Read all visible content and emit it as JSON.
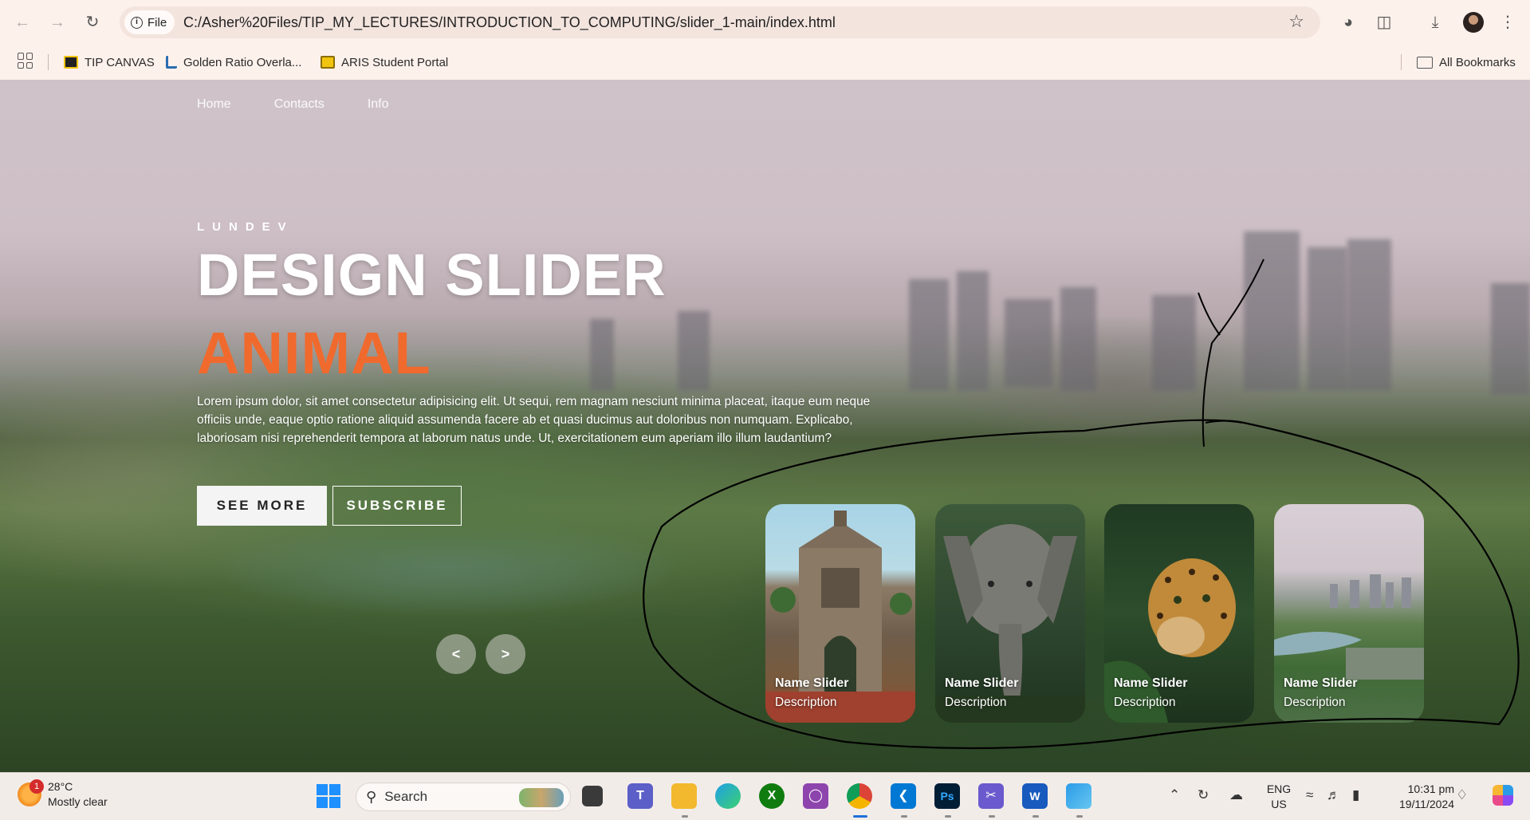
{
  "browser": {
    "back_icon": "back-arrow-icon",
    "forward_icon": "forward-arrow-icon",
    "reload_icon": "reload-icon",
    "site_chip_label": "File",
    "url": "C:/Asher%20Files/TIP_MY_LECTURES/INTRODUCTION_TO_COMPUTING/slider_1-main/index.html",
    "bookmarks": [
      {
        "label": "TIP CANVAS",
        "icon": "tip-canvas-favicon"
      },
      {
        "label": "Golden Ratio Overla...",
        "icon": "golden-ratio-favicon"
      },
      {
        "label": "ARIS Student Portal",
        "icon": "aris-favicon"
      }
    ],
    "all_bookmarks_label": "All Bookmarks"
  },
  "page": {
    "nav": [
      "Home",
      "Contacts",
      "Info"
    ],
    "author": "LUNDEV",
    "title": "DESIGN SLIDER",
    "topic": "ANIMAL",
    "description": "Lorem ipsum dolor, sit amet consectetur adipisicing elit. Ut sequi, rem magnam nesciunt minima placeat, itaque eum neque officiis unde, eaque optio ratione aliquid assumenda facere ab et quasi ducimus aut doloribus non numquam. Explicabo, laboriosam nisi reprehenderit tempora at laborum natus unde. Ut, exercitationem eum aperiam illo illum laudantium?",
    "buttons": {
      "see_more": "SEE MORE",
      "subscribe": "SUBSCRIBE"
    },
    "arrows": {
      "prev": "<",
      "next": ">"
    },
    "thumbnails": [
      {
        "name": "Name Slider",
        "description": "Description",
        "image": "fort-santiago-gate"
      },
      {
        "name": "Name Slider",
        "description": "Description",
        "image": "elephant"
      },
      {
        "name": "Name Slider",
        "description": "Description",
        "image": "leopard"
      },
      {
        "name": "Name Slider",
        "description": "Description",
        "image": "city-park-aerial"
      }
    ]
  },
  "taskbar": {
    "weather": {
      "temp": "28°C",
      "condition": "Mostly clear",
      "badge": "1"
    },
    "search_label": "Search",
    "tray": {
      "lang_top": "ENG",
      "lang_bottom": "US",
      "time": "10:31 pm",
      "date": "19/11/2024"
    },
    "apps": [
      "start",
      "search",
      "task-view",
      "teams",
      "file-explorer",
      "edge",
      "xbox",
      "copilot-app",
      "chrome",
      "vscode",
      "photoshop",
      "snipping-tool",
      "word",
      "photos"
    ]
  },
  "colors": {
    "accent_orange": "#f06a2e",
    "browser_bg": "#fdf1ec",
    "taskbar_bg": "#f2ece9"
  }
}
